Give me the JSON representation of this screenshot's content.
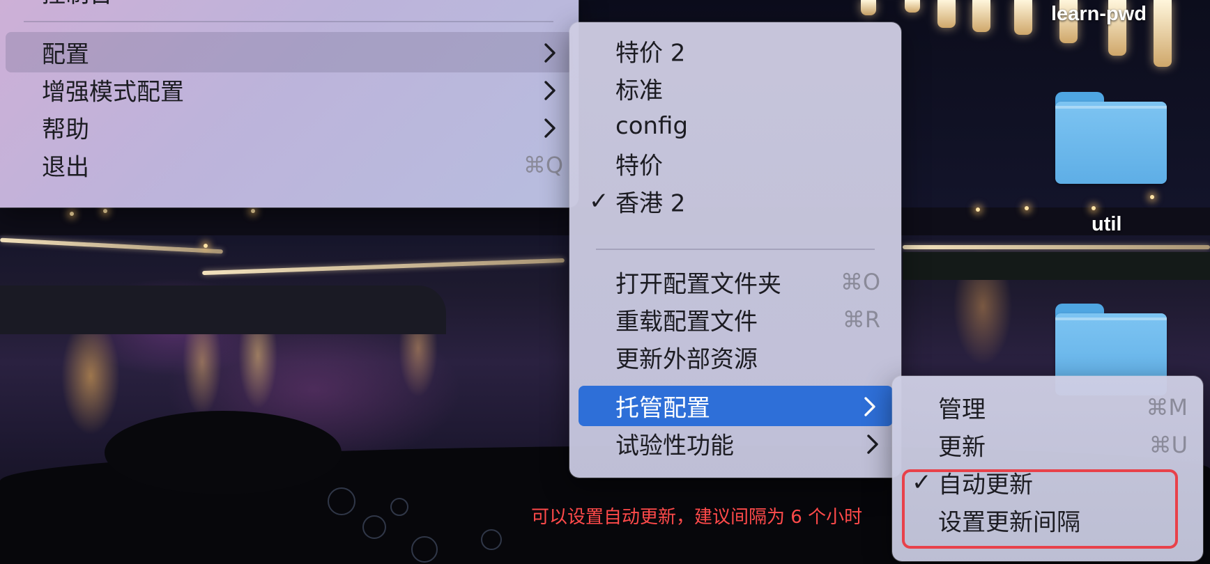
{
  "desktop": {
    "items": [
      {
        "label": "learn-pwd"
      },
      {
        "label": "util"
      }
    ]
  },
  "main_menu": {
    "partial_top_item": "控制台",
    "items": [
      {
        "label": "配置",
        "submenu": true
      },
      {
        "label": "增强模式配置",
        "submenu": true
      },
      {
        "label": "帮助",
        "submenu": true
      },
      {
        "label": "退出",
        "shortcut": "⌘Q"
      }
    ]
  },
  "config_menu": {
    "profiles": [
      {
        "label": "特价 2",
        "checked": false
      },
      {
        "label": "标准",
        "checked": false
      },
      {
        "label": "config",
        "checked": false
      },
      {
        "label": "特价",
        "checked": false
      },
      {
        "label": "香港 2",
        "checked": true
      }
    ],
    "check_mark": "✓",
    "actions": [
      {
        "label": "打开配置文件夹",
        "shortcut": "⌘O"
      },
      {
        "label": "重载配置文件",
        "shortcut": "⌘R"
      },
      {
        "label": "更新外部资源"
      },
      {
        "label": "托管配置",
        "submenu": true
      },
      {
        "label": "试验性功能",
        "submenu": true
      }
    ]
  },
  "managed_menu": {
    "items": [
      {
        "label": "管理",
        "shortcut": "⌘M"
      },
      {
        "label": "更新",
        "shortcut": "⌘U"
      },
      {
        "label": "自动更新",
        "checked": true
      },
      {
        "label": "设置更新间隔"
      }
    ]
  },
  "annotation": {
    "text": "可以设置自动更新，建议间隔为 6 个小时",
    "color": "#e8414a"
  },
  "colors": {
    "selection": "#2e6fd8",
    "annotation": "#e8414a"
  },
  "icons": [
    "chevron-right-icon",
    "checkmark-icon",
    "folder-icon"
  ]
}
